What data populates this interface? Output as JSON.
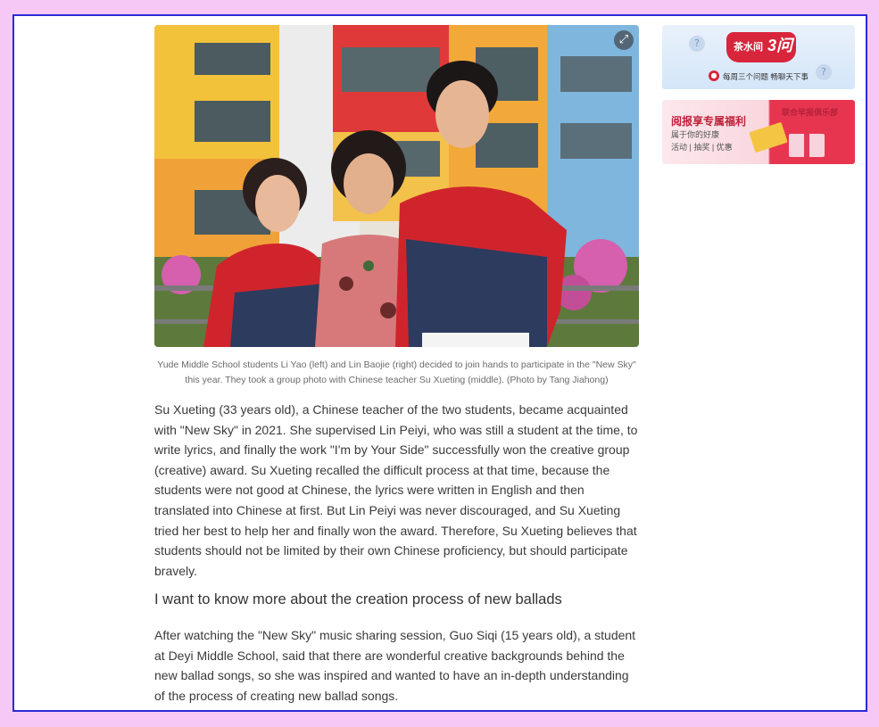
{
  "article": {
    "photo_alt": "Yude Middle School students with teacher",
    "caption": "Yude Middle School students Li Yao (left) and Lin Baojie (right) decided to join hands to participate in the \"New Sky\" this year. They took a group photo with Chinese teacher Su Xueting (middle). (Photo by Tang Jiahong)",
    "paragraph1": "Su Xueting (33 years old), a Chinese teacher of the two students, became acquainted with \"New Sky\" in 2021. She supervised Lin Peiyi, who was still a student at the time, to write lyrics, and finally the work \"I'm by Your Side\" successfully won the creative group (creative) award. Su Xueting recalled the difficult process at that time, because the students were not good at Chinese, the lyrics were written in English and then translated into Chinese at first. But Lin Peiyi was never discouraged, and Su Xueting tried her best to help her and finally won the award. Therefore, Su Xueting believes that students should not be limited by their own Chinese proficiency, but should participate bravely.",
    "heading": "I want to know more about the creation process of new ballads",
    "paragraph2": "After watching the \"New Sky\" music sharing session, Guo Siqi (15 years old), a student at Deyi Middle School, said that there are wonderful creative backgrounds behind the new ballad songs, so she was inspired and wanted to have an in-depth understanding of the process of creating new ballad songs.",
    "expand_icon": "expand-icon"
  },
  "sidebar": {
    "ad1": {
      "title": "茶水间",
      "number": "3问",
      "subtitle": "每周三个问题 畅聊天下事",
      "bubble": "?",
      "mic_icon": "mic-icon"
    },
    "ad2": {
      "brand": "联合早报俱乐部",
      "title": "阅报享专属福利",
      "line2": "属于你的好康",
      "line3": "活动 | 抽奖 | 优惠"
    }
  },
  "colors": {
    "background": "#f6c8f6",
    "frame_border": "#2b2bd6",
    "accent_red": "#d8253c",
    "text": "#3a3a3a"
  }
}
